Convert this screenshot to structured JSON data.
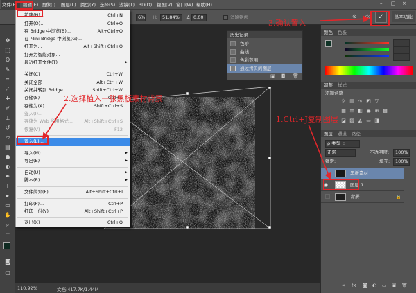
{
  "menubar": {
    "items": [
      "文件(F)",
      "编辑(E)",
      "图像(I)",
      "图层(L)",
      "类型(Y)",
      "选择(S)",
      "滤镜(T)",
      "3D(D)",
      "视图(V)",
      "窗口(W)",
      "帮助(H)"
    ]
  },
  "options": {
    "zoom_field": "6%",
    "h_label": "H:",
    "h_value": "51.84%",
    "angle_value": "0.00",
    "interp_label": "消除锯齿",
    "workspace": "基本功能"
  },
  "file_menu": {
    "items": [
      {
        "label": "新建(N)...",
        "shortcut": "Ctrl+N"
      },
      {
        "label": "打开(O)...",
        "shortcut": "Ctrl+O"
      },
      {
        "label": "在 Bridge 中浏览(B)...",
        "shortcut": "Alt+Ctrl+O"
      },
      {
        "label": "在 Mini Bridge 中浏览(G)...",
        "shortcut": ""
      },
      {
        "label": "打开为...",
        "shortcut": "Alt+Shift+Ctrl+O"
      },
      {
        "label": "打开为智能对象...",
        "shortcut": ""
      },
      {
        "label": "最近打开文件(T)",
        "shortcut": ""
      },
      {
        "label": "关闭(C)",
        "shortcut": "Ctrl+W"
      },
      {
        "label": "关闭全部",
        "shortcut": "Alt+Ctrl+W"
      },
      {
        "label": "关闭并转到 Bridge...",
        "shortcut": "Shift+Ctrl+W"
      },
      {
        "label": "存储(S)",
        "shortcut": "Ctrl+S"
      },
      {
        "label": "存储为(A)...",
        "shortcut": "Shift+Ctrl+S"
      },
      {
        "label": "签入(I)...",
        "shortcut": ""
      },
      {
        "label": "存储为 Web 所用格式...",
        "shortcut": "Alt+Shift+Ctrl+S"
      },
      {
        "label": "恢复(V)",
        "shortcut": "F12"
      },
      {
        "label": "置入(L)...",
        "shortcut": ""
      },
      {
        "label": "导入(M)",
        "shortcut": ""
      },
      {
        "label": "导出(E)",
        "shortcut": ""
      },
      {
        "label": "自动(U)",
        "shortcut": ""
      },
      {
        "label": "脚本(R)",
        "shortcut": ""
      },
      {
        "label": "文件简介(F)...",
        "shortcut": "Alt+Shift+Ctrl+I"
      },
      {
        "label": "打印(P)...",
        "shortcut": "Ctrl+P"
      },
      {
        "label": "打印一份(Y)",
        "shortcut": "Alt+Shift+Ctrl+P"
      },
      {
        "label": "退出(X)",
        "shortcut": "Ctrl+Q"
      }
    ]
  },
  "history": {
    "title": "历史记录",
    "items": [
      "色阶",
      "曲线",
      "色彩范围",
      "通过拷贝的图层"
    ]
  },
  "color_panel": {
    "tabs": [
      "颜色",
      "色板"
    ],
    "values": [
      "",
      "",
      ""
    ]
  },
  "adjust_panel": {
    "tabs": [
      "调整",
      "样式"
    ],
    "hint": "添加调整"
  },
  "layers_panel": {
    "tabs": [
      "图层",
      "通道",
      "路径"
    ],
    "blend": "正常",
    "opacity_label": "不透明度:",
    "opacity": "100%",
    "lock_label": "锁定:",
    "fill_label": "填充:",
    "fill": "100%",
    "layers": [
      "黑板素材",
      "图层 1",
      "背景"
    ]
  },
  "status": {
    "zoom": "110.92%",
    "doc": "文档:417.7K/1.44M"
  },
  "annotations": {
    "step1": "1.Ctrl+J复制图层",
    "step2": "2.选择植入一张黑板素材背景",
    "step3": "3.确认置入"
  },
  "colors": {
    "annotation_red": "#e2262a",
    "highlight_blue": "#3c8be8"
  }
}
